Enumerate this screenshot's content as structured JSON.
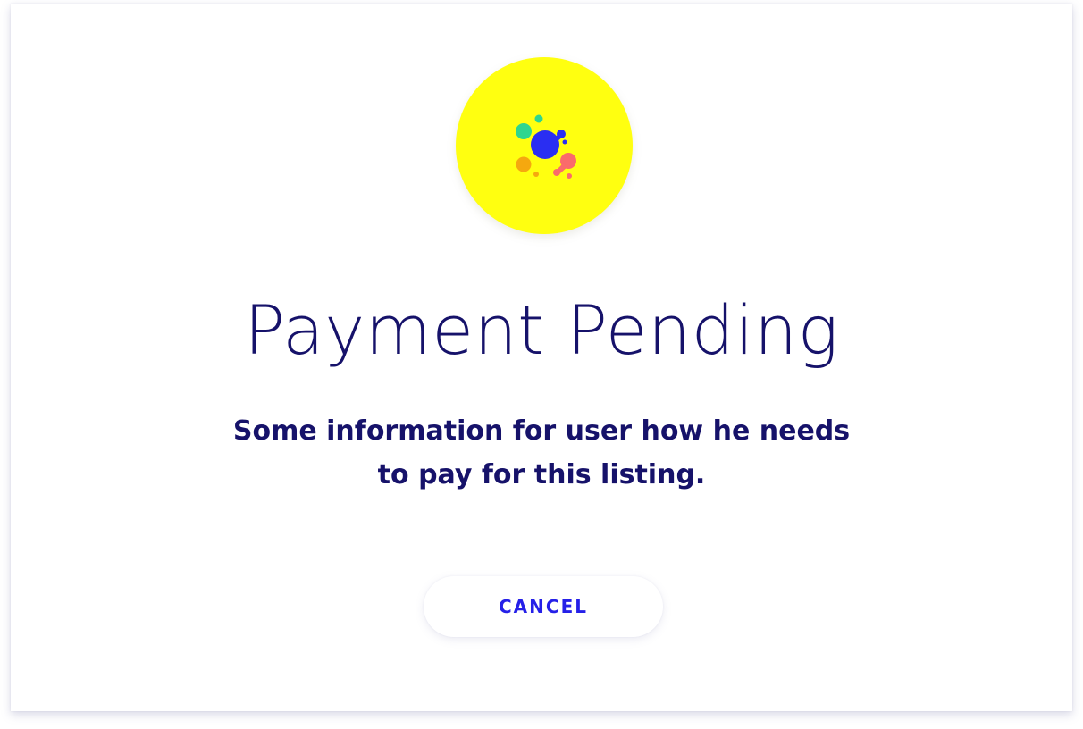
{
  "dialog": {
    "title": "Payment Pending",
    "message": "Some information for user how he needs to pay for this listing.",
    "cancel_label": "CANCEL"
  },
  "logo": {
    "icon": "splash-dots-icon",
    "background_color": "#ffff10",
    "dot_colors": [
      "#2a2ef2",
      "#2ed68f",
      "#f5a80f",
      "#fa6b6b"
    ]
  },
  "colors": {
    "text": "#16126a",
    "accent": "#2520e8"
  }
}
